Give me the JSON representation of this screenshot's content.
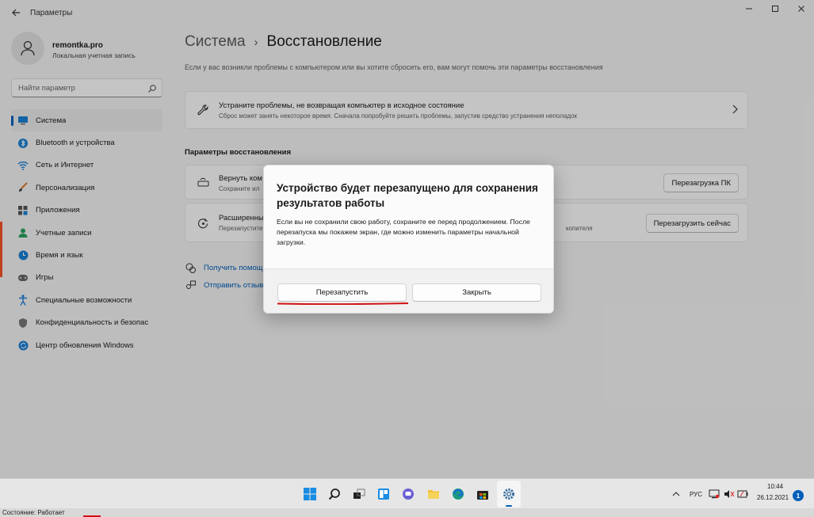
{
  "window": {
    "title": "Параметры",
    "back_icon": "back-arrow-icon",
    "controls": [
      "minimize-icon",
      "maximize-icon",
      "close-icon"
    ]
  },
  "account": {
    "name": "remontka.pro",
    "type": "Локальная учетная запись"
  },
  "search": {
    "placeholder": "Найти параметр"
  },
  "sidebar": {
    "items": [
      {
        "label": "Система",
        "icon": "monitor-icon",
        "active": true
      },
      {
        "label": "Bluetooth и устройства",
        "icon": "bluetooth-icon"
      },
      {
        "label": "Сеть и Интернет",
        "icon": "network-icon"
      },
      {
        "label": "Персонализация",
        "icon": "brush-icon"
      },
      {
        "label": "Приложения",
        "icon": "apps-icon"
      },
      {
        "label": "Учетные записи",
        "icon": "person-icon"
      },
      {
        "label": "Время и язык",
        "icon": "globe-clock-icon"
      },
      {
        "label": "Игры",
        "icon": "gamepad-icon"
      },
      {
        "label": "Специальные возможности",
        "icon": "accessibility-icon"
      },
      {
        "label": "Конфиденциальность и безопас",
        "icon": "shield-icon"
      },
      {
        "label": "Центр обновления Windows",
        "icon": "update-icon"
      }
    ]
  },
  "main": {
    "breadcrumb_parent": "Система",
    "breadcrumb_sep": "›",
    "breadcrumb_current": "Восстановление",
    "description": "Если у вас возникли проблемы с компьютером или вы хотите сбросить его, вам могут помочь эти параметры восстановления",
    "troubleshoot": {
      "title": "Устраните проблемы, не возвращая компьютер в исходное состояние",
      "subtitle": "Сброс может занять некоторое время. Сначала попробуйте решить проблемы, запустив средство устранения неполадок"
    },
    "section_title": "Параметры восстановления",
    "reset": {
      "title": "Вернуть ком",
      "subtitle": "Сохраните ил",
      "button": "Перезагрузка ПК"
    },
    "advanced": {
      "title": "Расширенны",
      "subtitle": "Перезапустите",
      "subtitle_tail": "копителя",
      "button": "Перезагрузить сейчас"
    },
    "links": [
      {
        "label": "Получить помощ",
        "icon": "help-icon"
      },
      {
        "label": "Отправить отзыв",
        "icon": "feedback-icon"
      }
    ]
  },
  "dialog": {
    "title": "Устройство будет перезапущено для сохранения результатов работы",
    "body": "Если вы не сохранили свою работу, сохраните ее перед продолжением. После перезапуска мы покажем экран, где можно изменить параметры начальной загрузки.",
    "primary": "Перезапустить",
    "secondary": "Закрыть"
  },
  "taskbar": {
    "apps": [
      "windows-start-icon",
      "search-icon",
      "task-view-icon",
      "widgets-icon",
      "teams-chat-icon",
      "file-explorer-icon",
      "edge-icon",
      "store-icon",
      "settings-gear-icon"
    ],
    "language": "РУС",
    "time": "10:44",
    "date": "26.12.2021",
    "notifications": "1"
  },
  "status": {
    "text": "Состояние: Работает"
  },
  "colors": {
    "accent": "#005fb8",
    "annotation_red": "#d01010"
  }
}
